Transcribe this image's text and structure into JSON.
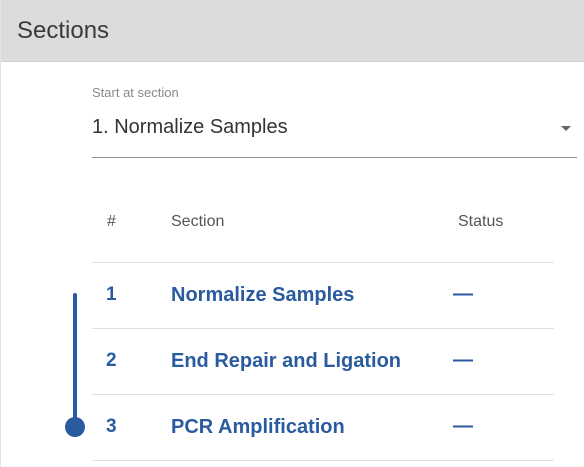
{
  "header": {
    "title": "Sections"
  },
  "start_select": {
    "label": "Start at section",
    "value": "1. Normalize Samples",
    "icon": "chevron-down-icon"
  },
  "table": {
    "columns": {
      "num": "#",
      "section": "Section",
      "status": "Status"
    },
    "rows": [
      {
        "num": "1",
        "section": "Normalize Samples",
        "status": "—"
      },
      {
        "num": "2",
        "section": "End Repair and Ligation",
        "status": "—"
      },
      {
        "num": "3",
        "section": "PCR Amplification",
        "status": "—"
      }
    ]
  },
  "colors": {
    "accent": "#2a5b9e",
    "header_bg": "#dcdcdc",
    "divider": "#e0e0e0"
  }
}
